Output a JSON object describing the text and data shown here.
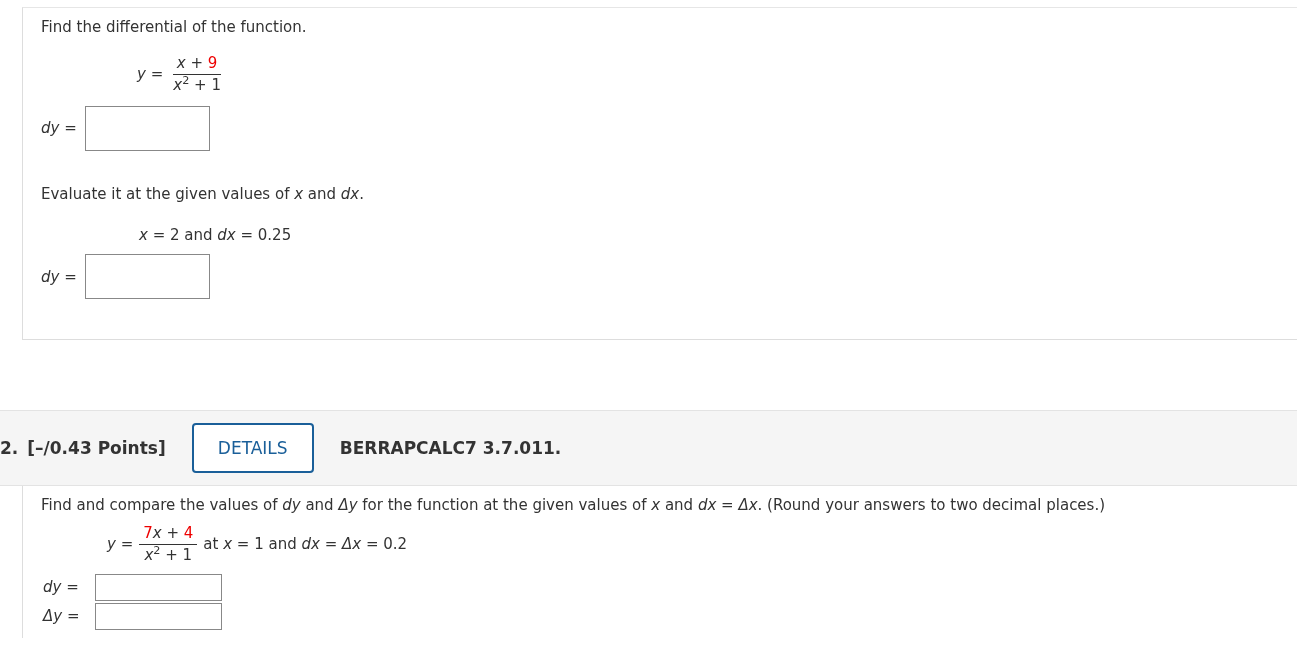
{
  "question_1": {
    "blocks": [
      {
        "kind": "text",
        "text": "Find the differential of the function."
      },
      {
        "kind": "equation",
        "lhs": "*y* =",
        "numerator": [
          {
            "kind": "plain",
            "text": "*x* + "
          },
          {
            "kind": "given",
            "text": "9"
          }
        ],
        "denominator": "*x*$^{2}$ + 1"
      },
      {
        "kind": "answer-large",
        "label": "*dy* ="
      },
      {
        "kind": "text",
        "text": "Evaluate it at the given values of *x* and *dx*."
      },
      {
        "kind": "given",
        "text": "*x* = 2 and *dx* = 0.25"
      },
      {
        "kind": "answer-large",
        "label": "*dy* ="
      }
    ]
  },
  "question_2": {
    "header": {
      "number": "2.",
      "points": "[–/0.43 Points]",
      "details_button": "DETAILS",
      "code": "BERRAPCALC7 3.7.011."
    },
    "blocks": [
      {
        "kind": "text",
        "text": "Find and compare the values of *dy* and *Δy* for the function at the given values of *x* and *dx* = *Δx*. (Round your answers to two decimal places.)"
      },
      {
        "kind": "equation",
        "lhs": "*y* =",
        "numerator": [
          {
            "kind": "given",
            "text": "7"
          },
          {
            "kind": "plain",
            "text": "*x* + "
          },
          {
            "kind": "given",
            "text": "4"
          }
        ],
        "denominator": "*x*$^{2}$ + 1",
        "suffix": "at *x* = 1 and *dx* = *Δx* = 0.2"
      },
      {
        "kind": "answer-small",
        "label": "*dy* ="
      },
      {
        "kind": "answer-small",
        "label": "*Δy* ="
      }
    ]
  }
}
